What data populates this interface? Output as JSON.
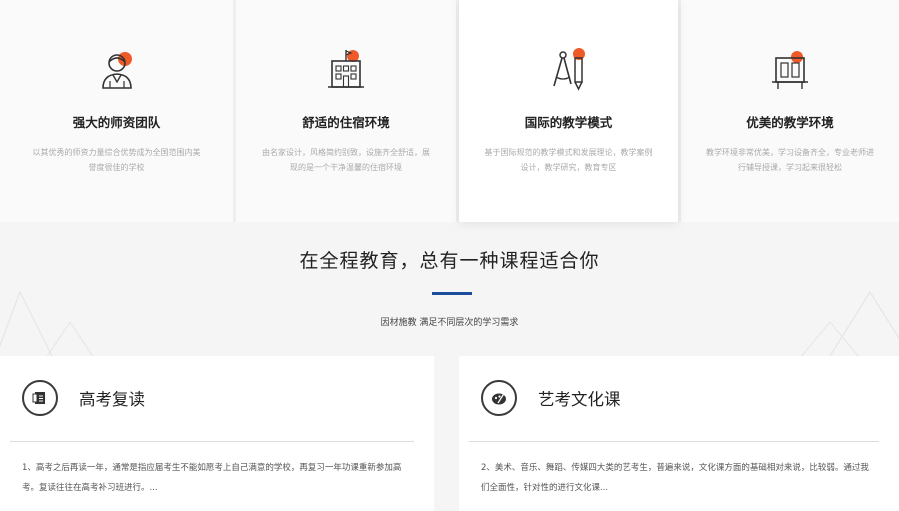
{
  "features": [
    {
      "icon": "teacher-icon",
      "title": "强大的师资团队",
      "desc": "以其优秀的师资力量综合优势成为全国范围内美誉度很佳的学校"
    },
    {
      "icon": "building-icon",
      "title": "舒适的住宿环境",
      "desc": "由名家设计，风格简约别致，设施齐全舒适，展现的是一个干净温馨的住宿环境"
    },
    {
      "icon": "compass-pencil-icon",
      "title": "国际的教学模式",
      "desc": "基于国际规范的教学模式和发展理论，教学案例设计，教学研究，教育专区"
    },
    {
      "icon": "desk-icon",
      "title": "优美的教学环境",
      "desc": "教学环境非常优美，学习设备齐全，专业老师进行辅导授课，学习起来很轻松"
    }
  ],
  "section": {
    "title": "在全程教育，总有一种课程适合你",
    "subtitle": "因材施教 满足不同层次的学习需求"
  },
  "courses": [
    {
      "icon": "document-icon",
      "title": "高考复读",
      "text": "1、高考之后再读一年，通常是指应届考生不能如愿考上自己满意的学校，再复习一年功课重新参加高考。复读往往在高考补习班进行。..."
    },
    {
      "icon": "palette-icon",
      "title": "艺考文化课",
      "text": "2、美术、音乐、舞蹈、传媒四大类的艺考生，普遍来说，文化课方面的基础相对来说，比较弱。通过我们全面性，针对性的进行文化课..."
    }
  ],
  "colors": {
    "accent": "#f05a28",
    "title_bar": "#1b4d9b"
  }
}
